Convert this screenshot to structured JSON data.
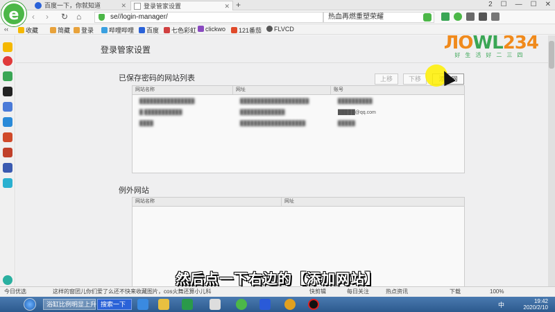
{
  "browser": {
    "tabs": [
      {
        "label": "百度一下，你就知道",
        "close": "✕"
      },
      {
        "label": "登录管家设置",
        "close": "✕"
      }
    ],
    "new_tab": "+",
    "window_controls": [
      "2",
      "☐",
      "—",
      "☐",
      "✕"
    ],
    "url": "se//login-manager/",
    "search_value": "热血再燃重塑荣耀",
    "nav": {
      "back": "‹",
      "forward": "›",
      "refresh": "↻",
      "home": "⌂"
    }
  },
  "bookmarks": {
    "toggle": "‹‹",
    "items": [
      "收藏",
      "简藏",
      "登录",
      "哔哩哔哩",
      "百度",
      "七色彩虹",
      "clickwo",
      "121番茄",
      "FLVCD"
    ]
  },
  "page": {
    "title": "登录管家设置",
    "brand": {
      "logo": "ЛOWL234",
      "slogan": "好生活好二三四"
    },
    "saved_section": {
      "title": "已保存密码的网站列表",
      "buttons": {
        "up": "上移",
        "down": "下移",
        "add": "添加网站"
      },
      "columns": [
        "网站名称",
        "网址",
        "账号"
      ],
      "rows": [
        {
          "name": "████████████████",
          "url": "████████████████████",
          "account": "██████████"
        },
        {
          "name": "█ ███████████",
          "url": "█████████████",
          "account": "█████@qq.com"
        },
        {
          "name": "████",
          "url": "███████████████████",
          "account": "█████"
        }
      ]
    },
    "exception_section": {
      "title": "例外网站",
      "columns": [
        "网站名称",
        "网址"
      ]
    }
  },
  "subtitle": "然后点一下右边的【添加网站】",
  "statusbar": {
    "left": "今日优选",
    "news": "这样的窗团儿你们爱了么还不快来收藏图片，cos火舞还算小儿科",
    "items": [
      "快剪辑",
      "每日关注",
      "热点资讯",
      "下载",
      "100%"
    ]
  },
  "taskbar": {
    "items": [
      "浴缸比例明显上升",
      "搜索一下"
    ],
    "time": "19:42",
    "date": "2020/2/10",
    "lang": "中"
  }
}
